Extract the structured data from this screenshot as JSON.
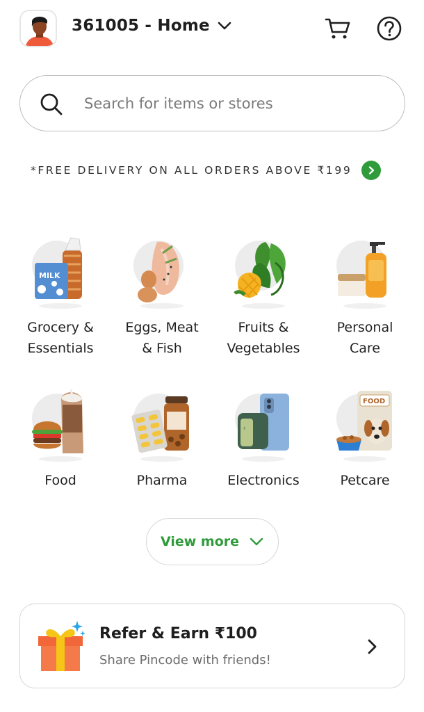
{
  "header": {
    "location": "361005 - Home",
    "cart_icon": "cart-icon",
    "help_icon": "help-icon"
  },
  "search": {
    "placeholder": "Search for items or stores",
    "icon": "search-icon"
  },
  "banner": {
    "text": "*FREE DELIVERY ON ALL ORDERS ABOVE ₹199",
    "accent_color": "#2f9b3b"
  },
  "categories": [
    {
      "label": "Grocery & Essentials",
      "line1": "Grocery &",
      "line2": "Essentials",
      "icon": "grocery-icon"
    },
    {
      "label": "Eggs, Meat & Fish",
      "line1": "Eggs, Meat",
      "line2": "& Fish",
      "icon": "eggs-meat-fish-icon"
    },
    {
      "label": "Fruits & Vegetables",
      "line1": "Fruits &",
      "line2": "Vegetables",
      "icon": "fruits-vegetables-icon"
    },
    {
      "label": "Personal Care",
      "line1": "Personal",
      "line2": "Care",
      "icon": "personal-care-icon"
    },
    {
      "label": "Food",
      "line1": "Food",
      "line2": "",
      "icon": "food-icon"
    },
    {
      "label": "Pharma",
      "line1": "Pharma",
      "line2": "",
      "icon": "pharma-icon"
    },
    {
      "label": "Electronics",
      "line1": "Electronics",
      "line2": "",
      "icon": "electronics-icon"
    },
    {
      "label": "Petcare",
      "line1": "Petcare",
      "line2": "",
      "icon": "petcare-icon"
    }
  ],
  "view_more": {
    "label": "View more"
  },
  "refer": {
    "title": "Refer & Earn ₹100",
    "subtitle": "Share Pincode with friends!",
    "icon": "gift-icon"
  },
  "illustration_text": {
    "milk": "MILK",
    "food": "FOOD"
  }
}
